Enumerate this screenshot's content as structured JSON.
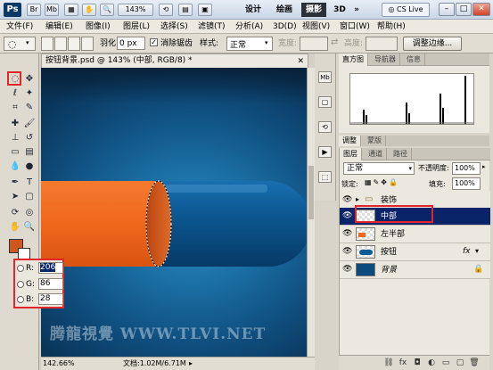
{
  "appbar": {
    "logo": "Ps",
    "bridge": "Br",
    "minibridge": "Mb",
    "zoom": "143%",
    "workspaces": [
      "设计",
      "绘画",
      "摄影",
      "3D"
    ],
    "active_workspace": "摄影",
    "more": "»",
    "cs_live": "CS Live",
    "min": "–",
    "max": "□",
    "close": "✕"
  },
  "menu": [
    "文件(F)",
    "编辑(E)",
    "图像(I)",
    "图层(L)",
    "选择(S)",
    "滤镜(T)",
    "分析(A)",
    "3D(D)",
    "视图(V)",
    "窗口(W)",
    "帮助(H)"
  ],
  "options": {
    "feather_label": "羽化:",
    "feather_value": "0 px",
    "antialias_label": "消除锯齿",
    "style_label": "样式:",
    "style_value": "正常",
    "width_label": "宽度:",
    "height_label": "高度:",
    "refine_edge": "调整边缘..."
  },
  "document": {
    "tab_title": "按钮背景.psd @ 143% (中部, RGB/8) *",
    "zoom": "142.66%",
    "doc_info": "文档:1.02M/6.71M"
  },
  "color_readout": {
    "r_label": "R:",
    "r": "206",
    "g_label": "G:",
    "g": "86",
    "b_label": "B:",
    "b": "28"
  },
  "panels": {
    "top_tabs": [
      "直方图",
      "导航器",
      "信息"
    ],
    "adjust_tabs": [
      "调整",
      "蒙版"
    ],
    "layer_tabs": [
      "图层",
      "通道",
      "路径"
    ],
    "blend_mode": "正常",
    "opacity_label": "不透明度:",
    "opacity_value": "100%",
    "lock_label": "锁定:",
    "fill_label": "填充:",
    "fill_value": "100%"
  },
  "layers": [
    {
      "name": "装饰",
      "type": "group"
    },
    {
      "name": "中部",
      "selected": true
    },
    {
      "name": "左半部"
    },
    {
      "name": "按钮",
      "fx": "fx"
    },
    {
      "name": "背景",
      "locked": true
    }
  ],
  "watermark": "腾龍視覺 WWW.TLVI.NET",
  "colors": {
    "capsule_orange": "#f0671c",
    "capsule_blue": "#0d5a95",
    "foreground_swatch": "#ce561c",
    "highlight_red": "#e3262b",
    "selection_blue": "#0a246a"
  }
}
